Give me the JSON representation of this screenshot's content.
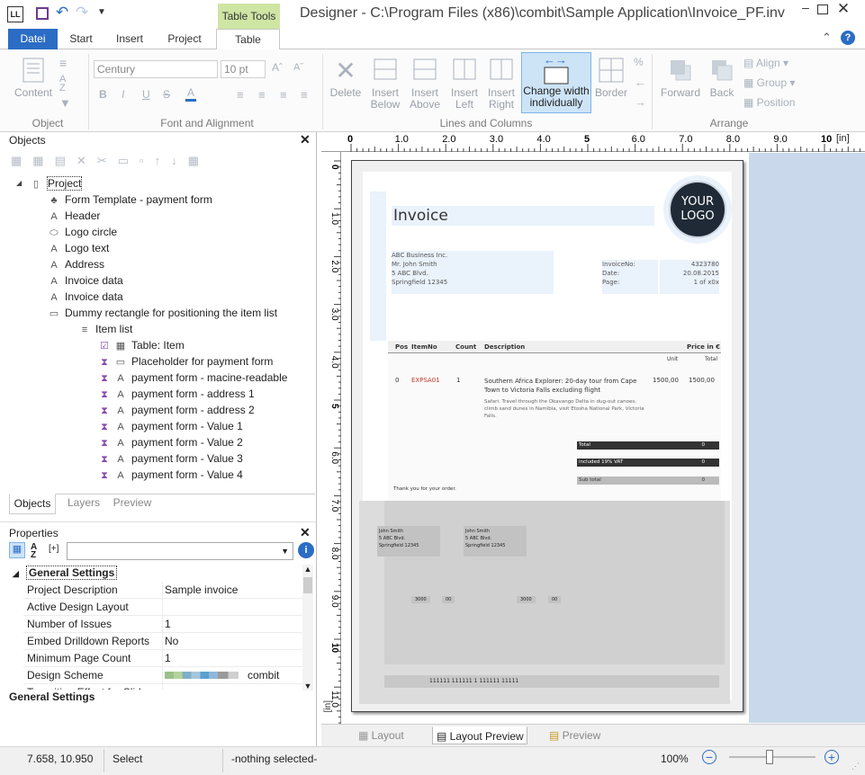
{
  "titlebar": {
    "context_tab": "Table Tools",
    "title": "Designer - C:\\Program Files (x86)\\combit\\Sample Application\\Invoice_PF.inv",
    "app_badge": "LL"
  },
  "tabs": [
    "Datei",
    "Start",
    "Insert",
    "Project",
    "Table"
  ],
  "ribbon": {
    "content_label": "Content",
    "object_group": "Object",
    "font_name": "Century",
    "font_size": "10 pt",
    "font_group": "Font and Alignment",
    "delete": "Delete",
    "insert_below": [
      "Insert",
      "Below"
    ],
    "insert_above": [
      "Insert",
      "Above"
    ],
    "insert_left": [
      "Insert",
      "Left"
    ],
    "insert_right": [
      "Insert",
      "Right"
    ],
    "change_width": [
      "Change width",
      "individually"
    ],
    "border": "Border",
    "lines_group": "Lines and Columns",
    "forward": "Forward",
    "back": "Back",
    "align": "Align",
    "group": "Group",
    "position": "Position",
    "arrange_group": "Arrange",
    "percent": "%"
  },
  "objects_panel": {
    "title": "Objects",
    "tree": [
      {
        "label": "Project",
        "icon": "page-icon",
        "indent": 0,
        "sel": true
      },
      {
        "label": "Form Template - payment form",
        "icon": "template-icon",
        "indent": 1
      },
      {
        "label": "Header",
        "icon": "A",
        "indent": 1
      },
      {
        "label": "Logo circle",
        "icon": "ellipse-icon",
        "indent": 1
      },
      {
        "label": "Logo text",
        "icon": "A",
        "indent": 1
      },
      {
        "label": "Address",
        "icon": "A",
        "indent": 1
      },
      {
        "label": "Invoice data",
        "icon": "A",
        "indent": 1
      },
      {
        "label": "Invoice data",
        "icon": "A",
        "indent": 1
      },
      {
        "label": "Dummy rectangle for positioning the item list",
        "icon": "rect-icon",
        "indent": 1
      },
      {
        "label": "Item list",
        "icon": "list-icon",
        "indent": 2
      },
      {
        "label": "Table: Item",
        "icon": "table-icon",
        "indent": 3
      },
      {
        "label": "Placeholder for payment form",
        "icon": "rect-icon",
        "indent": 3
      },
      {
        "label": "payment form - macine-readable",
        "icon": "A",
        "indent": 3
      },
      {
        "label": "payment form - address 1",
        "icon": "A",
        "indent": 3
      },
      {
        "label": "payment form - address 2",
        "icon": "A",
        "indent": 3
      },
      {
        "label": "payment form - Value 1",
        "icon": "A",
        "indent": 3
      },
      {
        "label": "payment form - Value 2",
        "icon": "A",
        "indent": 3
      },
      {
        "label": "payment form - Value 3",
        "icon": "A",
        "indent": 3
      },
      {
        "label": "payment form - Value 4",
        "icon": "A",
        "indent": 3
      }
    ],
    "bottom_tabs": [
      "Objects",
      "Layers",
      "Preview"
    ]
  },
  "properties_panel": {
    "title": "Properties",
    "group": "General Settings",
    "rows": [
      {
        "k": "Project Description",
        "v": "Sample invoice"
      },
      {
        "k": "Active Design Layout",
        "v": ""
      },
      {
        "k": "Number of Issues",
        "v": "1"
      },
      {
        "k": "Embed Drilldown Reports",
        "v": "No"
      },
      {
        "k": "Minimum Page Count",
        "v": "1"
      },
      {
        "k": "Design Scheme",
        "v": "combit"
      },
      {
        "k": "Transition Effect for Slid",
        "v": ""
      }
    ],
    "footer": "General Settings"
  },
  "ruler": {
    "h_ticks": [
      "0",
      "1.0",
      "2.0",
      "3.0",
      "4.0",
      "5",
      "6.0",
      "7.0",
      "8.0",
      "9.0",
      "10"
    ],
    "unit": "[in]",
    "v_ticks": [
      "0",
      "1.0",
      "2.0",
      "3.0",
      "4.0",
      "5",
      "6.0",
      "7.0",
      "8.0",
      "9.0",
      "10",
      "11.0"
    ]
  },
  "invoice": {
    "title": "Invoice",
    "logo": [
      "YOUR",
      "LOGO"
    ],
    "address": [
      "ABC Business Inc.",
      "Mr. John Smith",
      "5 ABC Blvd.",
      "Springfield 12345"
    ],
    "meta_labels": [
      "InvoiceNo:",
      "Date:",
      "Page:"
    ],
    "meta_values": [
      "4323780",
      "20.08.2015",
      "1 of x0x"
    ],
    "cols": [
      "Pos",
      "ItemNo",
      "Count",
      "Description",
      "Price in €"
    ],
    "subcols": [
      "Unit",
      "Total"
    ],
    "item": {
      "pos": "0",
      "no": "EXPSA01",
      "count": "1",
      "desc": "Southern Africa Explorer: 20-day tour from Cape Town to Victoria Falls excluding flight",
      "detail": "Safari: Travel through the Okavango Delta in dug-out canoes, climb sand dunes in Namibia, visit Etosha National Park, Victoria Falls.",
      "unit": "1500,00",
      "total": "1500,00"
    },
    "totals": [
      {
        "l": "Total",
        "v": "0"
      },
      {
        "l": "included 19% VAT",
        "v": "0"
      },
      {
        "l": "Sub total",
        "v": "0"
      }
    ],
    "thanks": "Thank you for your order.",
    "payer": [
      "John Smith",
      "5 ABC Blvd.",
      "Springfield 12345"
    ],
    "amounts": [
      "3000",
      "00",
      "3000",
      "00"
    ],
    "mrz": "111111 111111 1 111111 11111"
  },
  "view_tabs": [
    "Layout",
    "Layout Preview",
    "Preview"
  ],
  "status": {
    "coords": "7.658, 10.950",
    "mode": "Select",
    "selection": "-nothing selected-",
    "zoom": "100%"
  },
  "colors": {
    "accent": "#2b6cc4",
    "context": "#cfe5a4",
    "canvas": "#c9d8ea"
  }
}
